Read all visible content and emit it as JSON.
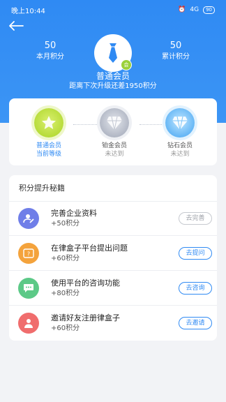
{
  "status_bar": {
    "time": "晚上10:44",
    "signal": "4G",
    "battery": "90"
  },
  "header": {
    "left_stat": {
      "value": "50",
      "label": "本月积分"
    },
    "right_stat": {
      "value": "50",
      "label": "累计积分"
    },
    "avatar_badge": "会",
    "member_level": "普通会员",
    "upgrade_hint": "距离下次升级还差1950积分"
  },
  "levels": [
    {
      "name": "普通会员",
      "state": "当前等级"
    },
    {
      "name": "铂金会员",
      "state": "未达到"
    },
    {
      "name": "钻石会员",
      "state": "未达到"
    }
  ],
  "tips": {
    "title": "积分提升秘籍",
    "tasks": [
      {
        "title": "完善企业资料",
        "points": "+50积分",
        "button": "去完善",
        "icon_color": "#6f7ee8",
        "icon_name": "edit-profile-icon"
      },
      {
        "title": "在律盒子平台提出问题",
        "points": "+60积分",
        "button": "去提问",
        "icon_color": "#f4a33c",
        "icon_name": "question-icon"
      },
      {
        "title": "使用平台的咨询功能",
        "points": "+80积分",
        "button": "去咨询",
        "icon_color": "#5cc987",
        "icon_name": "chat-icon"
      },
      {
        "title": "邀请好友注册律盒子",
        "points": "+60积分",
        "button": "去邀请",
        "icon_color": "#f06d6d",
        "icon_name": "invite-user-icon"
      }
    ]
  },
  "colors": {
    "brand": "#2f8af3",
    "background": "#f2f3f6"
  }
}
